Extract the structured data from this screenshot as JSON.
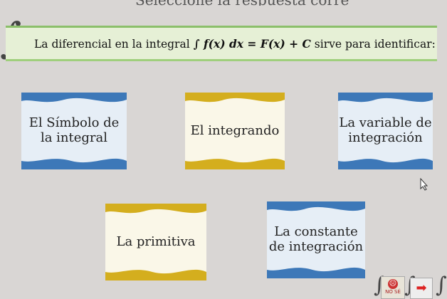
{
  "header": {
    "title": "Seleccione la respuesta correcta"
  },
  "question": {
    "text_before": "La diferencial en la integral",
    "formula": "∫ f(x) dx = F(x) + C",
    "text_after": "sirve para identificar:"
  },
  "options": [
    {
      "label": "El Símbolo de\nla integral",
      "style": "blue"
    },
    {
      "label": "El integrando",
      "style": "yellow"
    },
    {
      "label": "La variable de\nintegración",
      "style": "blue"
    },
    {
      "label": "La primitiva",
      "style": "yellow"
    },
    {
      "label": "La constante\nde integración",
      "style": "blue"
    }
  ],
  "controls": {
    "no_se_label": "NO SÉ",
    "next_icon": "arrow-right-icon"
  },
  "colors": {
    "blue_wave": "#3d78b8",
    "yellow_wave": "#d4ae1e",
    "question_border": "#8bbf6a"
  }
}
